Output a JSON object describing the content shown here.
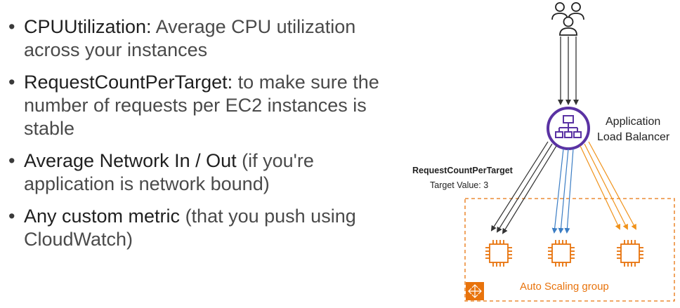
{
  "bullets": [
    {
      "strong": "CPUUtilization:",
      "rest": " Average CPU utilization across your instances"
    },
    {
      "strong": "RequestCountPerTarget:",
      "rest": " to make sure the number of requests per EC2 instances is stable"
    },
    {
      "strong": "Average Network In / Out",
      "rest": " (if you're application is network bound)"
    },
    {
      "strong": "Any custom metric",
      "rest": " (that you push using CloudWatch)"
    }
  ],
  "diagram": {
    "alb_label_line1": "Application",
    "alb_label_line2": "Load Balancer",
    "metric_name": "RequestCountPerTarget",
    "metric_target": "Target Value: 3",
    "asg_label": "Auto Scaling group",
    "colors": {
      "alb": "#5a32a3",
      "ec2": "#e8730c",
      "asg_border": "#e8730c",
      "arrow_gray": "#333333",
      "arrow_blue": "#3b7dc4",
      "arrow_orange": "#f0921a"
    },
    "icons": [
      "users-icon",
      "load-balancer-icon",
      "ec2-instance-icon",
      "auto-scaling-icon"
    ]
  }
}
